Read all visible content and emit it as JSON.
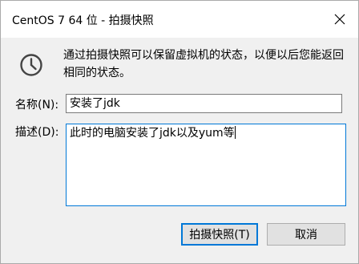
{
  "window": {
    "title": "CentOS 7 64 位 - 拍摄快照",
    "close_icon": "close-icon"
  },
  "info": {
    "icon": "clock-icon",
    "text": "通过拍摄快照可以保留虚拟机的状态，以便以后您能返回相同的状态。"
  },
  "form": {
    "name_label": "名称(N):",
    "name_value": "安装了jdk",
    "desc_label": "描述(D):",
    "desc_value": "此时的电脑安装了jdk以及yum等"
  },
  "buttons": {
    "ok_label": "拍摄快照(T)",
    "cancel_label": "取消"
  },
  "colors": {
    "focus_accent": "#0078d7",
    "dialog_bg": "#f0f0f0"
  }
}
